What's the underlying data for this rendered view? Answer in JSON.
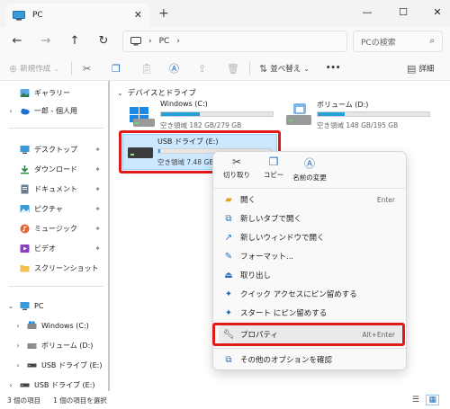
{
  "window": {
    "tab_title": "PC",
    "tab_close": "✕",
    "new_tab": "+",
    "minimize": "—",
    "maximize": "☐",
    "close": "✕"
  },
  "nav": {
    "back": "←",
    "forward": "→",
    "up": "↑",
    "refresh": "↻",
    "breadcrumb_sep": "›",
    "breadcrumb_location": "PC",
    "search_placeholder": "PCの検索",
    "search_icon": "⌕"
  },
  "commands": {
    "new": "新規作成",
    "sort": "並べ替え",
    "more": "•••",
    "details": "詳細"
  },
  "sidebar": {
    "gallery": "ギャラリー",
    "personal": "一郎 - 個人用",
    "desktop": "デスクトップ",
    "downloads": "ダウンロード",
    "documents": "ドキュメント",
    "pictures": "ピクチャ",
    "music": "ミュージック",
    "videos": "ビデオ",
    "screenshots": "スクリーンショット",
    "pc": "PC",
    "windows_c": "Windows (C:)",
    "volume_d": "ボリューム (D:)",
    "usb_e_1": "USB ドライブ (E:)",
    "usb_e_2": "USB ドライブ (E:)",
    "pin": "✦"
  },
  "main": {
    "section_title": "デバイスとドライブ",
    "drives": [
      {
        "name": "Windows (C:)",
        "free_text": "空き領域 182 GB/279 GB",
        "used_fraction": 0.35
      },
      {
        "name": "ボリューム (D:)",
        "free_text": "空き領域 148 GB/195 GB",
        "used_fraction": 0.24
      },
      {
        "name": "USB ドライブ (E:)",
        "free_text": "空き領域 7.48 GB/",
        "used_fraction": 0.02
      }
    ]
  },
  "context_menu": {
    "top_buttons": {
      "cut": "切り取り",
      "copy": "コピー",
      "rename": "名前の変更"
    },
    "items": {
      "open": "開く",
      "open_shortcut": "Enter",
      "open_new_tab": "新しいタブで開く",
      "open_new_window": "新しいウィンドウで開く",
      "format": "フォーマット...",
      "eject": "取り出し",
      "pin_quick": "クイック アクセスにピン留めする",
      "pin_start": "スタート にピン留めする",
      "properties": "プロパティ",
      "properties_shortcut": "Alt+Enter",
      "more_options": "その他のオプションを確認"
    }
  },
  "status": {
    "count": "3 個の項目",
    "selected": "1 個の項目を選択"
  },
  "colors": {
    "accent": "#0067c0",
    "drive_fill": "#26a0da",
    "highlight_outline": "#e01919",
    "selection": "#cce8ff"
  }
}
